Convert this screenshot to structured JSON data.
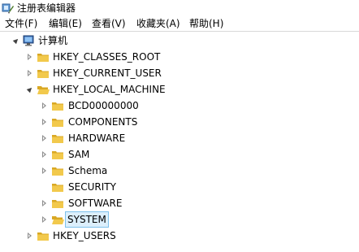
{
  "window": {
    "title": "注册表编辑器",
    "app_icon": "registry-editor-icon"
  },
  "menu": [
    {
      "label": "文件(F)"
    },
    {
      "label": "编辑(E)"
    },
    {
      "label": "查看(V)"
    },
    {
      "label": "收藏夹(A)"
    },
    {
      "label": "帮助(H)"
    }
  ],
  "tree": {
    "root": {
      "label": "计算机",
      "icon": "computer-icon",
      "expanded": true
    },
    "hives": [
      {
        "label": "HKEY_CLASSES_ROOT",
        "expanded": false
      },
      {
        "label": "HKEY_CURRENT_USER",
        "expanded": false
      },
      {
        "label": "HKEY_LOCAL_MACHINE",
        "expanded": true
      },
      {
        "label": "HKEY_USERS",
        "expanded": false
      }
    ],
    "local_machine_children": [
      {
        "label": "BCD00000000",
        "expandable": true
      },
      {
        "label": "COMPONENTS",
        "expandable": true
      },
      {
        "label": "HARDWARE",
        "expandable": true
      },
      {
        "label": "SAM",
        "expandable": true
      },
      {
        "label": "Schema",
        "expandable": true
      },
      {
        "label": "SECURITY",
        "expandable": false
      },
      {
        "label": "SOFTWARE",
        "expandable": true
      },
      {
        "label": "SYSTEM",
        "expandable": true,
        "selected": true
      }
    ]
  },
  "colors": {
    "folder": "#f2c94c",
    "folder_dark": "#d9a824",
    "selection_bg": "#dceffc",
    "selection_border": "#7dc1ec"
  }
}
